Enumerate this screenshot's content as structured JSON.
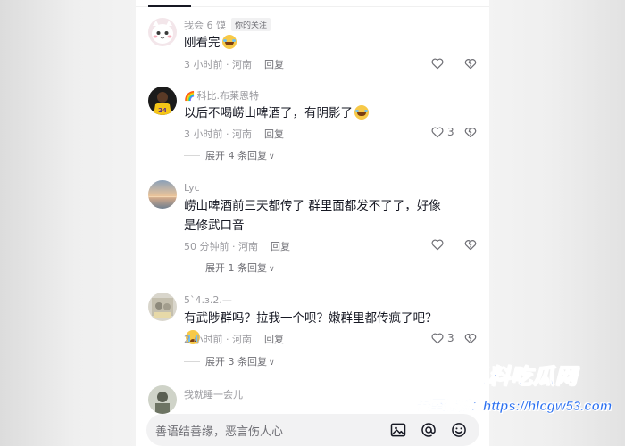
{
  "comments": [
    {
      "username": "我会 6 馍",
      "badge": "你的关注",
      "text": "刚看完",
      "emoji": "laugh",
      "time_location": "3 小时前 · 河南",
      "reply_label": "回复",
      "like_count": ""
    },
    {
      "username": "科比.布莱恩特",
      "username_prefix_emoji": "🌈",
      "text": "以后不喝崂山啤酒了，有阴影了",
      "emoji": "laugh",
      "time_location": "3 小时前 · 河南",
      "reply_label": "回复",
      "like_count": "3",
      "expand_label": "展开 4 条回复"
    },
    {
      "username": "Lyc",
      "text": "崂山啤酒前三天都传了 群里面都发不了了，好像是修武口音",
      "time_location": "50 分钟前 · 河南",
      "reply_label": "回复",
      "like_count": "",
      "expand_label": "展开 1 条回复"
    },
    {
      "username": "5`4.з.2.—",
      "text": "有武陟群吗？拉我一个呗？嫩群里都传疯了吧？",
      "emoji": "cry",
      "time_location": "2 小时前 · 河南",
      "reply_label": "回复",
      "like_count": "3",
      "expand_label": "展开 3 条回复"
    },
    {
      "username": "我就睡一会儿"
    }
  ],
  "input": {
    "placeholder": "善语结善缘，恶言伤人心"
  },
  "watermark": {
    "line1": "黑料吃瓜网",
    "line2": "吾至最新：https://hlcgw53.com"
  },
  "colors": {
    "text_primary": "#161823",
    "text_secondary": "#9a9a9f",
    "watermark_blue": "#2a6ff0"
  }
}
